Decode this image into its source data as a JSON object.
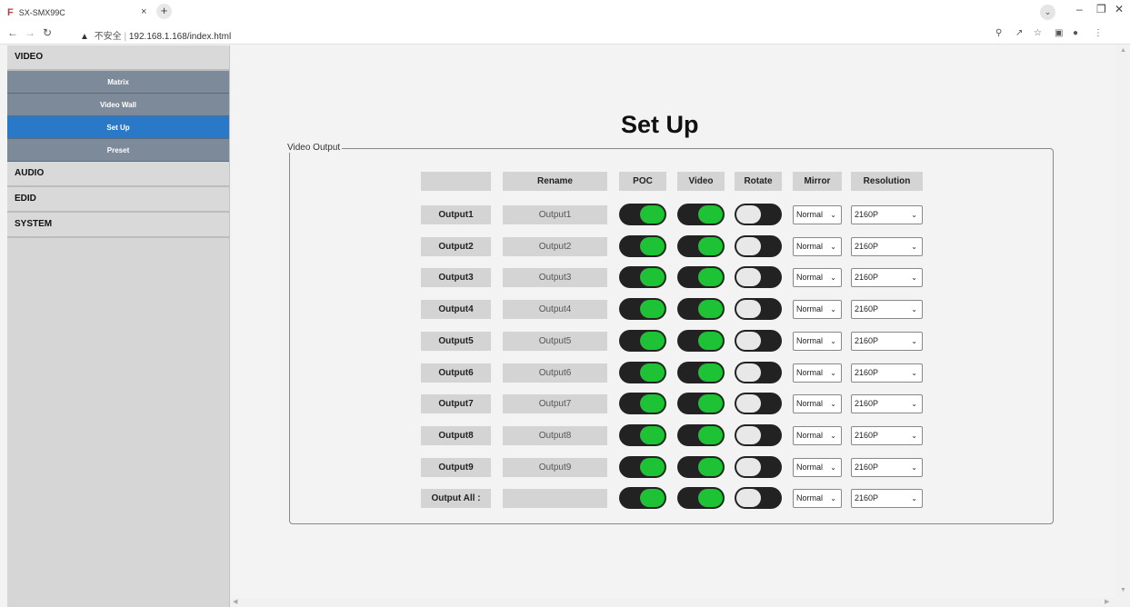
{
  "browser": {
    "tab_icon": "F",
    "tab_title": "SX-SMX99C",
    "tab_close": "×",
    "new_tab": "+",
    "security_label": "不安全",
    "url": "192.168.1.168/index.html"
  },
  "sidebar": {
    "categories": [
      {
        "label": "VIDEO"
      },
      {
        "label": "AUDIO"
      },
      {
        "label": "EDID"
      },
      {
        "label": "SYSTEM"
      }
    ],
    "video_items": [
      {
        "label": "Matrix",
        "active": false
      },
      {
        "label": "Video Wall",
        "active": false
      },
      {
        "label": "Set Up",
        "active": true
      },
      {
        "label": "Preset",
        "active": false
      }
    ]
  },
  "page": {
    "title": "Set Up",
    "section_legend": "Video Output"
  },
  "table": {
    "headers": [
      "",
      "Rename",
      "POC",
      "Video",
      "Rotate",
      "Mirror",
      "Resolution"
    ],
    "rows": [
      {
        "name": "Output1",
        "rename": "Output1",
        "poc": true,
        "video": true,
        "rotate": false,
        "mirror": "Normal",
        "resolution": "2160P"
      },
      {
        "name": "Output2",
        "rename": "Output2",
        "poc": true,
        "video": true,
        "rotate": false,
        "mirror": "Normal",
        "resolution": "2160P"
      },
      {
        "name": "Output3",
        "rename": "Output3",
        "poc": true,
        "video": true,
        "rotate": false,
        "mirror": "Normal",
        "resolution": "2160P"
      },
      {
        "name": "Output4",
        "rename": "Output4",
        "poc": true,
        "video": true,
        "rotate": false,
        "mirror": "Normal",
        "resolution": "2160P"
      },
      {
        "name": "Output5",
        "rename": "Output5",
        "poc": true,
        "video": true,
        "rotate": false,
        "mirror": "Normal",
        "resolution": "2160P"
      },
      {
        "name": "Output6",
        "rename": "Output6",
        "poc": true,
        "video": true,
        "rotate": false,
        "mirror": "Normal",
        "resolution": "2160P"
      },
      {
        "name": "Output7",
        "rename": "Output7",
        "poc": true,
        "video": true,
        "rotate": false,
        "mirror": "Normal",
        "resolution": "2160P"
      },
      {
        "name": "Output8",
        "rename": "Output8",
        "poc": true,
        "video": true,
        "rotate": false,
        "mirror": "Normal",
        "resolution": "2160P"
      },
      {
        "name": "Output9",
        "rename": "Output9",
        "poc": true,
        "video": true,
        "rotate": false,
        "mirror": "Normal",
        "resolution": "2160P"
      },
      {
        "name": "Output All :",
        "rename": "",
        "poc": true,
        "video": true,
        "rotate": false,
        "mirror": "Normal",
        "resolution": "2160P"
      }
    ]
  },
  "colors": {
    "toggle_on": "#1ec235",
    "toggle_track": "#222222",
    "active_menu": "#2a78c8",
    "submenu": "#7d8a99"
  }
}
